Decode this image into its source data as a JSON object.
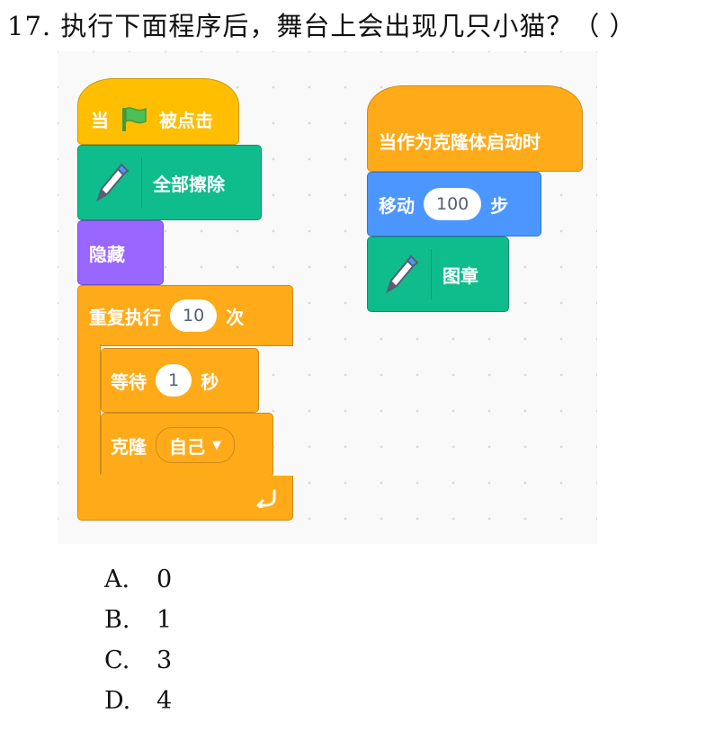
{
  "question": {
    "text": "17. 执行下面程序后，舞台上会出现几只小猫？（ ）"
  },
  "script_main": {
    "when_flag_prefix": "当",
    "when_flag_suffix": "被点击",
    "pen_clear": "全部擦除",
    "hide": "隐藏",
    "repeat_prefix": "重复执行",
    "repeat_count": "10",
    "repeat_suffix": "次",
    "wait_prefix": "等待",
    "wait_value": "1",
    "wait_suffix": "秒",
    "clone_label": "克隆",
    "clone_target": "自己"
  },
  "script_clone": {
    "hat": "当作为克隆体启动时",
    "move_prefix": "移动",
    "move_value": "100",
    "move_suffix": "步",
    "stamp": "图章"
  },
  "options": [
    {
      "letter": "A.",
      "value": "0"
    },
    {
      "letter": "B.",
      "value": "1"
    },
    {
      "letter": "C.",
      "value": "3"
    },
    {
      "letter": "D.",
      "value": "4"
    }
  ],
  "colors": {
    "events": "#ffbf00",
    "pen": "#0fbd8c",
    "looks": "#9966ff",
    "control": "#ffab19",
    "motion": "#4c97ff"
  }
}
